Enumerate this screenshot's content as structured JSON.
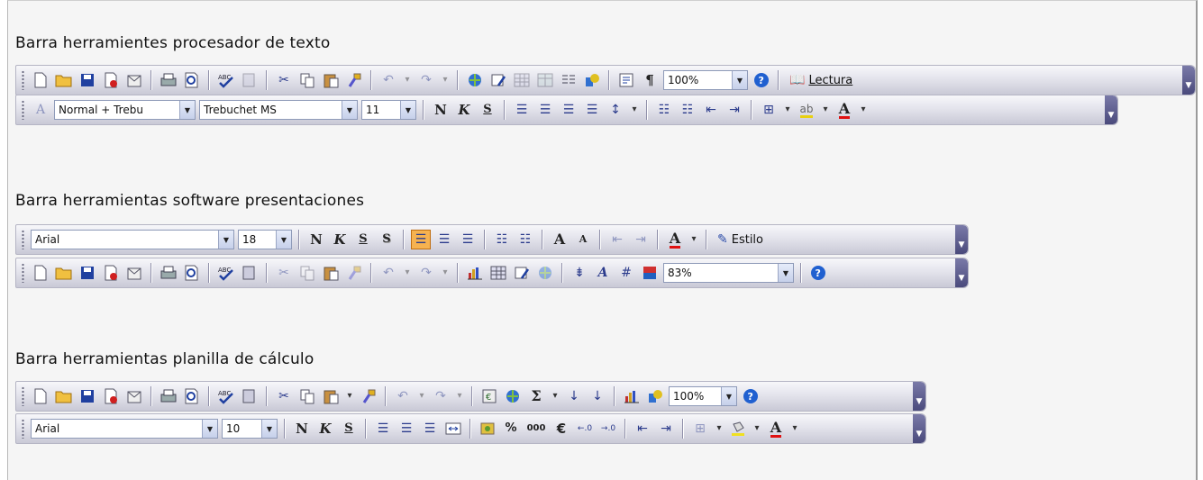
{
  "sections": [
    {
      "title": "Barra herramientes procesador de texto",
      "standard": {
        "zoom": "100%",
        "reading_label": "Lectura",
        "reading_accesskey": "L"
      },
      "format": {
        "style": "Normal + Trebu",
        "font": "Trebuchet MS",
        "size": "11",
        "bold": "N",
        "italic": "K",
        "underline": "S",
        "highlight_text": "ab",
        "font_color_glyph": "A"
      }
    },
    {
      "title": "Barra herramientas software presentaciones",
      "format": {
        "font": "Arial",
        "size": "18",
        "bold": "N",
        "italic": "K",
        "underline": "S",
        "shadow": "S",
        "grow_glyph": "A",
        "shrink_glyph": "A",
        "font_color_glyph": "A",
        "design_label": "Estilo"
      },
      "standard": {
        "zoom": "83%"
      }
    },
    {
      "title": "Barra herramientas planilla de cálculo",
      "standard": {
        "zoom": "100%",
        "sigma": "Σ"
      },
      "format": {
        "font": "Arial",
        "size": "10",
        "bold": "N",
        "italic": "K",
        "underline": "S",
        "percent": "%",
        "thousands": "000",
        "euro": "€",
        "font_color_glyph": "A"
      }
    }
  ],
  "colors": {
    "toolbar_chevron": "#4a4a7c",
    "font_color_red": "#e01010",
    "active_orange": "#f6b250"
  }
}
